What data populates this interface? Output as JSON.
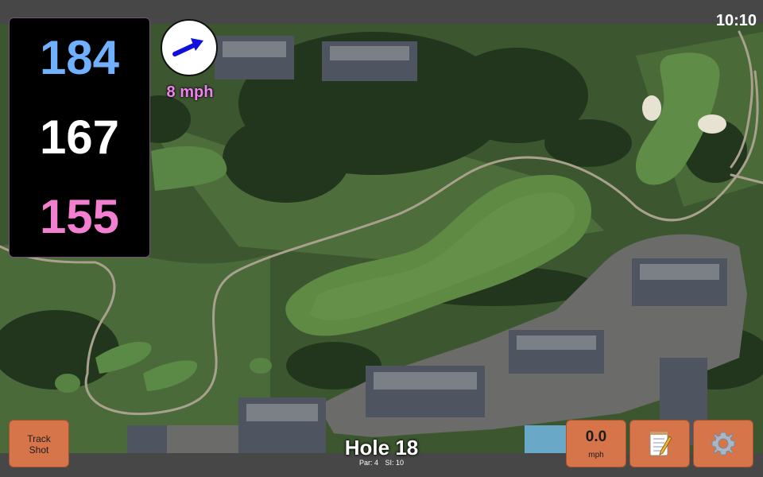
{
  "clock": "10:10",
  "distances": {
    "back": "184",
    "middle": "167",
    "front": "155",
    "colors": {
      "back": "#6fb0ff",
      "middle": "#ffffff",
      "front": "#f27fd0"
    }
  },
  "wind": {
    "speed_label": "8 mph",
    "direction_icon": "arrow-icon",
    "arrow_color": "#1010dd",
    "label_color": "#ee82ee"
  },
  "buttons": {
    "track_shot": "Track\nShot",
    "wind_value": "0.0",
    "wind_unit": "mph",
    "notes_icon": "notepad-icon",
    "settings_icon": "gear-icon"
  },
  "hole": {
    "title": "Hole 18",
    "par": "Par: 4",
    "si": "SI: 10"
  },
  "theme": {
    "button_color": "#d6744a",
    "bar_color": "#474747"
  }
}
